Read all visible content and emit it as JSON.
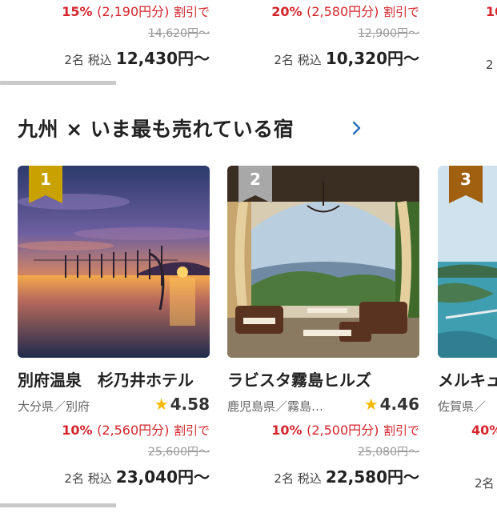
{
  "top_row": [
    {
      "discount_pct": "15%",
      "discount_amt": "(2,190円分)",
      "discount_label": "割引で",
      "original": "14,620円〜",
      "pax": "2名 税込",
      "price": "12,430円〜"
    },
    {
      "discount_pct": "20%",
      "discount_amt": "(2,580円分)",
      "discount_label": "割引で",
      "original": "12,900円〜",
      "pax": "2名 税込",
      "price": "10,320円〜"
    },
    {
      "discount_pct": "10",
      "discount_amt": "",
      "discount_label": "",
      "original": "",
      "pax": "2",
      "price": ""
    }
  ],
  "section": {
    "title": "九州 × いま最も売れている宿"
  },
  "colors": {
    "gold": "#c9a100",
    "silver": "#a8a8a8",
    "bronze": "#a0600f",
    "discount_red": "#d4252c",
    "star": "#f5b800",
    "link_blue": "#2a6fb8"
  },
  "cards": [
    {
      "rank": "1",
      "name": "別府温泉　杉乃井ホテル",
      "area": "大分県／別府",
      "rating": "4.58",
      "discount_pct": "10%",
      "discount_amt": "(2,560円分)",
      "discount_label": "割引で",
      "original": "25,600円〜",
      "pax": "2名 税込",
      "price": "23,040円〜"
    },
    {
      "rank": "2",
      "name": "ラビスタ霧島ヒルズ",
      "area": "鹿児島県／霧島…",
      "rating": "4.46",
      "discount_pct": "10%",
      "discount_amt": "(2,500円分)",
      "discount_label": "割引で",
      "original": "25,080円〜",
      "pax": "2名 税込",
      "price": "22,580円〜"
    },
    {
      "rank": "3",
      "name": "メルキュ",
      "area": "佐賀県／",
      "rating": "",
      "discount_pct": "40%",
      "discount_amt": "",
      "discount_label": "",
      "original": "",
      "pax": "2名",
      "price": ""
    }
  ]
}
